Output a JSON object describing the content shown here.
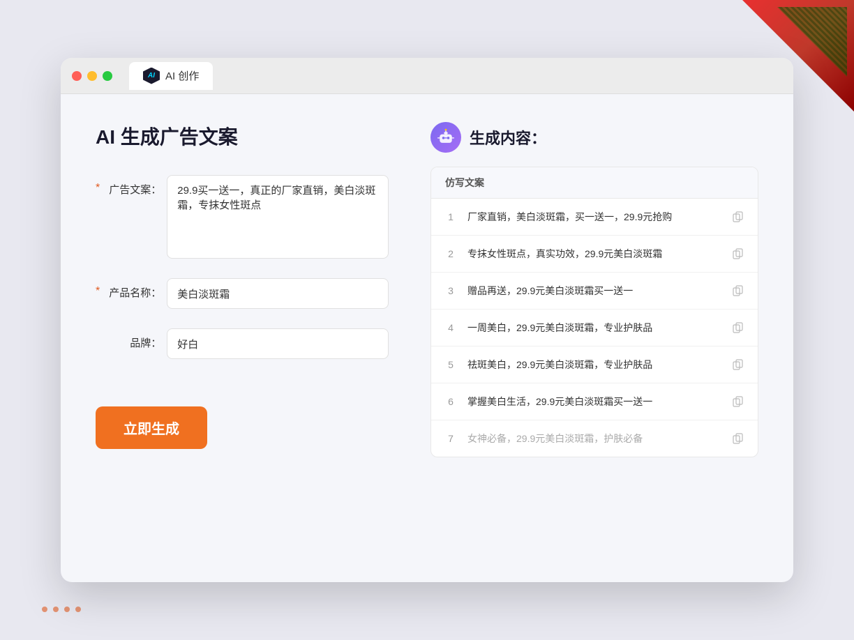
{
  "window": {
    "tab_label": "AI 创作"
  },
  "header": {
    "title": "AI 生成广告文案"
  },
  "form": {
    "ad_copy_label": "广告文案：",
    "ad_copy_required": "*",
    "ad_copy_value": "29.9买一送一，真正的厂家直销，美白淡斑霜，专抹女性斑点",
    "product_label": "产品名称：",
    "product_required": "*",
    "product_value": "美白淡斑霜",
    "brand_label": "品牌：",
    "brand_value": "好白",
    "generate_button": "立即生成"
  },
  "result": {
    "title": "生成内容：",
    "column_header": "仿写文案",
    "items": [
      {
        "num": "1",
        "text": "厂家直销，美白淡斑霜，买一送一，29.9元抢购",
        "muted": false
      },
      {
        "num": "2",
        "text": "专抹女性斑点，真实功效，29.9元美白淡斑霜",
        "muted": false
      },
      {
        "num": "3",
        "text": "赠品再送，29.9元美白淡斑霜买一送一",
        "muted": false
      },
      {
        "num": "4",
        "text": "一周美白，29.9元美白淡斑霜，专业护肤品",
        "muted": false
      },
      {
        "num": "5",
        "text": "祛斑美白，29.9元美白淡斑霜，专业护肤品",
        "muted": false
      },
      {
        "num": "6",
        "text": "掌握美白生活，29.9元美白淡斑霜买一送一",
        "muted": false
      },
      {
        "num": "7",
        "text": "女神必备，29.9元美白淡斑霜，护肤必备",
        "muted": true
      }
    ]
  }
}
